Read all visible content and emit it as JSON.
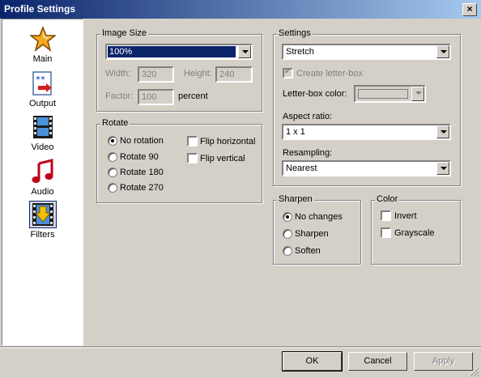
{
  "window": {
    "title": "Profile Settings"
  },
  "sidebar": {
    "items": [
      {
        "label": "Main",
        "icon": "star-icon"
      },
      {
        "label": "Output",
        "icon": "output-icon"
      },
      {
        "label": "Video",
        "icon": "film-icon"
      },
      {
        "label": "Audio",
        "icon": "music-note-icon"
      },
      {
        "label": "Filters",
        "icon": "filters-icon",
        "selected": true
      }
    ]
  },
  "image_size": {
    "legend": "Image Size",
    "size_value": "100%",
    "width_label": "Width:",
    "width_value": "320",
    "height_label": "Height:",
    "height_value": "240",
    "factor_label": "Factor:",
    "factor_value": "100",
    "factor_unit": "percent"
  },
  "rotate": {
    "legend": "Rotate",
    "options": [
      "No rotation",
      "Rotate 90",
      "Rotate 180",
      "Rotate 270"
    ],
    "selected": "No rotation",
    "flip_horizontal": "Flip horizontal",
    "flip_vertical": "Flip vertical"
  },
  "settings": {
    "legend": "Settings",
    "mode_value": "Stretch",
    "create_letterbox": "Create letter-box",
    "letterbox_color_label": "Letter-box color:",
    "aspect_label": "Aspect ratio:",
    "aspect_value": "1 x 1",
    "resampling_label": "Resampling:",
    "resampling_value": "Nearest"
  },
  "sharpen": {
    "legend": "Sharpen",
    "options": [
      "No changes",
      "Sharpen",
      "Soften"
    ],
    "selected": "No changes"
  },
  "color": {
    "legend": "Color",
    "invert": "Invert",
    "grayscale": "Grayscale"
  },
  "buttons": {
    "ok": "OK",
    "cancel": "Cancel",
    "apply": "Apply"
  },
  "colors": {
    "title_start": "#0a246a",
    "title_end": "#a6caf0",
    "face": "#d4d0c8",
    "selection": "#0a246a"
  }
}
